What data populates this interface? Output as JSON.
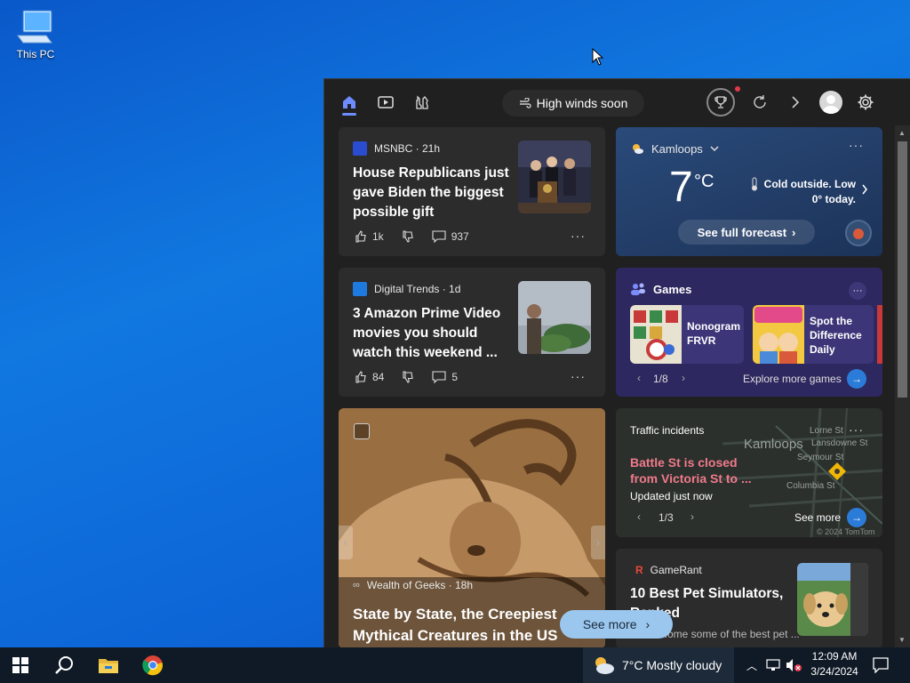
{
  "desktop": {
    "icon_label": "This PC"
  },
  "panel": {
    "alert": "High winds soon",
    "news1": {
      "source": "MSNBC · 21h",
      "headline": "House Republicans just gave Biden the biggest possible gift",
      "likes": "1k",
      "comments": "937"
    },
    "news2": {
      "source": "Digital Trends · 1d",
      "headline": "3 Amazon Prime Video movies you should watch this weekend ...",
      "likes": "84",
      "comments": "5"
    },
    "news3": {
      "source": "Wealth of Geeks · 18h",
      "headline": "State by State, the Creepiest Mythical Creatures in the US"
    },
    "weather": {
      "location": "Kamloops",
      "temp": "7",
      "unit": "°C",
      "summary": "Cold outside. Low 0° today.",
      "forecast_button": "See full forecast"
    },
    "games": {
      "title": "Games",
      "game1": "Nonogram FRVR",
      "game2": "Spot the Difference Daily",
      "pager": "1/8",
      "explore": "Explore more games"
    },
    "traffic": {
      "title": "Traffic incidents",
      "incident": "Battle St is closed from Victoria St to ...",
      "updated": "Updated just now",
      "pager": "1/3",
      "see_more": "See more",
      "map_city": "Kamloops",
      "street1": "Lorne St",
      "street2": "Lansdowne St",
      "street3": "Seymour St",
      "street4": "Columbia St",
      "copyright": "© 2024 TomTom"
    },
    "gamerant": {
      "source": "GameRant",
      "headline": "10 Best Pet Simulators, Ranked",
      "snippet": "...ome some of the best pet ..."
    },
    "see_more_button": "See more"
  },
  "taskbar": {
    "weather": "7°C  Mostly cloudy",
    "time": "12:09 AM",
    "date": "3/24/2024"
  }
}
